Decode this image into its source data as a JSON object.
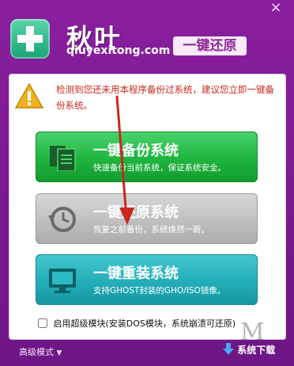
{
  "window": {
    "close_label": "×"
  },
  "header": {
    "brand_name": "秋叶",
    "domain": "qiuyexitong.com",
    "slogan": "一键还原"
  },
  "warning": {
    "text": "检测到您还未用本程序备份过系统，建议您立即一键备份系统。",
    "color": "#c9271e"
  },
  "actions": [
    {
      "title": "一键备份系统",
      "desc": "快速备份当前系统，保证系统安全。",
      "icon": "document-copy-icon",
      "color": "#1fb53e"
    },
    {
      "title": "一键还原系统",
      "desc": "恢复之前备份，系统焕然一新。",
      "icon": "restore-clock-icon",
      "color": "#bdbdbd"
    },
    {
      "title": "一键重装系统",
      "desc": "支持GHOST封装的GHO/ISO镜像。",
      "icon": "monitor-icon",
      "color": "#22adb8"
    }
  ],
  "options": {
    "super_module_label": "启用超级模块(安装DOS模块，系统崩溃可还原)",
    "super_module_checked": false
  },
  "footer": {
    "advanced_label": "高级模式",
    "download_label": "系统下载"
  }
}
